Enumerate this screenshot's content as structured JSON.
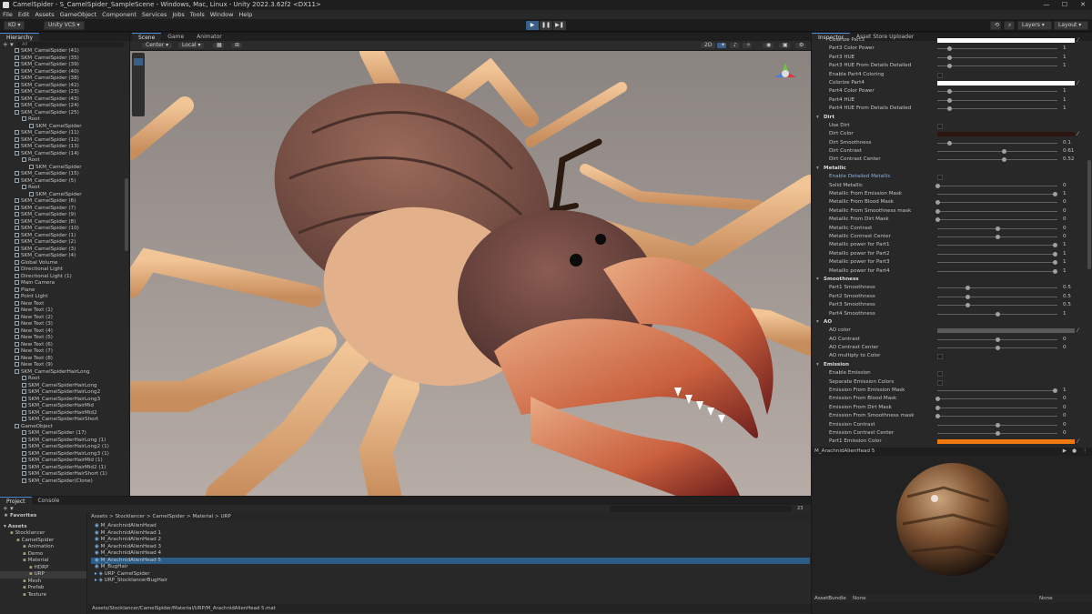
{
  "window": {
    "title": "CamelSpider - S_CamelSpider_SampleScene - Windows, Mac, Linux - Unity 2022.3.62f2 <DX11>",
    "controls": [
      "—",
      "☐",
      "✕"
    ]
  },
  "menu": [
    "File",
    "Edit",
    "Assets",
    "GameObject",
    "Component",
    "Services",
    "Jobs",
    "Tools",
    "Window",
    "Help"
  ],
  "toolbar": {
    "account": "KD ▾",
    "vcs": "Unity VCS ▾",
    "layers": "Layers ▾",
    "layout": "Layout ▾",
    "play": "▶",
    "pause": "❚❚",
    "step": "▶❚"
  },
  "hierarchy": {
    "tab": "Hierarchy",
    "search_placeholder": "All",
    "items": [
      "SKM_CamelSpider (41)",
      "SKM_CamelSpider (35)",
      "SKM_CamelSpider (39)",
      "SKM_CamelSpider (40)",
      "SKM_CamelSpider (38)",
      "SKM_CamelSpider (42)",
      "SKM_CamelSpider (23)",
      "SKM_CamelSpider (43)",
      "SKM_CamelSpider (24)",
      "SKM_CamelSpider (25)",
      "Root",
      "SKM_CamelSpider",
      "SKM_CamelSpider (11)",
      "SKM_CamelSpider (12)",
      "SKM_CamelSpider (13)",
      "SKM_CamelSpider (14)",
      "Root",
      "SKM_CamelSpider",
      "SKM_CamelSpider (15)",
      "SKM_CamelSpider (5)",
      "Root",
      "SKM_CamelSpider",
      "SKM_CamelSpider (6)",
      "SKM_CamelSpider (7)",
      "SKM_CamelSpider (9)",
      "SKM_CamelSpider (8)",
      "SKM_CamelSpider (10)",
      "SKM_CamelSpider (1)",
      "SKM_CamelSpider (2)",
      "SKM_CamelSpider (3)",
      "SKM_CamelSpider (4)",
      "Global Volume",
      "Directional Light",
      "Directional Light (1)",
      "Main Camera",
      "Plane",
      "Point Light",
      "New Text",
      "New Text (1)",
      "New Text (2)",
      "New Text (3)",
      "New Text (4)",
      "New Text (5)",
      "New Text (6)",
      "New Text (7)",
      "New Text (8)",
      "New Text (9)",
      "SKM_CamelSpiderHairLong",
      "Root",
      "SKM_CamelSpiderHairLong",
      "SKM_CamelSpiderHairLong2",
      "SKM_CamelSpiderHairLong3",
      "SKM_CamelSpiderHairMid",
      "SKM_CamelSpiderHairMid2",
      "SKM_CamelSpiderHairShort",
      "GameObject",
      "SKM_CamelSpider (17)",
      "SKM_CamelSpiderHairLong (1)",
      "SKM_CamelSpiderHairLong2 (1)",
      "SKM_CamelSpiderHairLong3 (1)",
      "SKM_CamelSpiderHairMid (1)",
      "SKM_CamelSpiderHairMid2 (1)",
      "SKM_CamelSpiderHairShort (1)",
      "SKM_CamelSpider(Clone)"
    ]
  },
  "scene": {
    "tabs": [
      "Scene",
      "Game",
      "Animator"
    ],
    "pivot": "Center ▾",
    "space": "Local ▾",
    "mode_2d": "2D"
  },
  "project": {
    "tabs": [
      "Project",
      "Console"
    ],
    "favorites": "Favorites",
    "assets_label": "Assets",
    "folders": [
      "Stocklancer",
      "CamelSpider",
      "Animation",
      "Demo",
      "Material",
      "HDRP",
      "URP",
      "Mesh",
      "Prefab",
      "Texture"
    ],
    "breadcrumb": "Assets > Stocklancer > CamelSpider > Material > URP",
    "files": [
      "M_ArachnidAlienHead",
      "M_ArachnidAlienHead 1",
      "M_ArachnidAlienHead 2",
      "M_ArachnidAlienHead 3",
      "M_ArachnidAlienHead 4",
      "M_ArachnidAlienHead 5",
      "M_BugHair",
      "URP_CamelSpider",
      "URP_StocklancerBugHair"
    ],
    "path": "Assets/Stocklancer/CamelSpider/Material/URP/M_ArachnidAlienHead 5.mat",
    "count": "23"
  },
  "inspector": {
    "tabs": [
      "Inspector",
      "Asset Store Uploader"
    ],
    "props": [
      {
        "label": "Colorize Part3",
        "type": "color",
        "color": "#ffffff"
      },
      {
        "label": "Part3 Color Power",
        "type": "slider",
        "value": "1",
        "pos": 0.1
      },
      {
        "label": "Part3 HUE",
        "type": "slider",
        "value": "1",
        "pos": 0.1
      },
      {
        "label": "Part3 HUE From Details Detailed",
        "type": "slider",
        "value": "1",
        "pos": 0.1
      },
      {
        "label": "Enable Part4 Coloring",
        "type": "check"
      },
      {
        "label": "Colorize Part4",
        "type": "color",
        "color": "#ffffff"
      },
      {
        "label": "Part4 Color Power",
        "type": "slider",
        "value": "1",
        "pos": 0.1
      },
      {
        "label": "Part4 HUE",
        "type": "slider",
        "value": "1",
        "pos": 0.1
      },
      {
        "label": "Part4 HUE From Details Detailed",
        "type": "slider",
        "value": "1",
        "pos": 0.1
      },
      {
        "label": "Dirt",
        "type": "header"
      },
      {
        "label": "Use Dirt",
        "type": "check"
      },
      {
        "label": "Dirt Color",
        "type": "color",
        "color": "#2a1510"
      },
      {
        "label": "Dirt Smoothness",
        "type": "slider",
        "value": "0.1",
        "pos": 0.1
      },
      {
        "label": "Dirt Contrast",
        "type": "slider",
        "value": "0.61",
        "pos": 0.55
      },
      {
        "label": "Dirt Contrast Center",
        "type": "slider",
        "value": "0.52",
        "pos": 0.55
      },
      {
        "label": "Metallic",
        "type": "header"
      },
      {
        "label": "Enable Detailed Metallic",
        "type": "check",
        "highlight": true
      },
      {
        "label": "Solid Metallic",
        "type": "slider",
        "value": "0",
        "pos": 0
      },
      {
        "label": "Metallic From Emission Mask",
        "type": "slider",
        "value": "1",
        "pos": 0.98
      },
      {
        "label": "Metallic From Blood Mask",
        "type": "slider",
        "value": "0",
        "pos": 0
      },
      {
        "label": "Metallic From Smoothness mask",
        "type": "slider",
        "value": "0",
        "pos": 0
      },
      {
        "label": "Metallic From Dirt Mask",
        "type": "slider",
        "value": "0",
        "pos": 0
      },
      {
        "label": "Metallic Contrast",
        "type": "slider",
        "value": "0",
        "pos": 0.5
      },
      {
        "label": "Metallic Contrast Center",
        "type": "slider",
        "value": "0",
        "pos": 0.5
      },
      {
        "label": "Metallic power for Part1",
        "type": "slider",
        "value": "1",
        "pos": 0.98
      },
      {
        "label": "Metallic power for Part2",
        "type": "slider",
        "value": "1",
        "pos": 0.98
      },
      {
        "label": "Metallic power for Part3",
        "type": "slider",
        "value": "1",
        "pos": 0.98
      },
      {
        "label": "Metallic power for Part4",
        "type": "slider",
        "value": "1",
        "pos": 0.98
      },
      {
        "label": "Smoothness",
        "type": "header"
      },
      {
        "label": "Part1 Smoothness",
        "type": "slider",
        "value": "0.5",
        "pos": 0.25
      },
      {
        "label": "Part2 Smoothness",
        "type": "slider",
        "value": "0.5",
        "pos": 0.25
      },
      {
        "label": "Part3 Smoothness",
        "type": "slider",
        "value": "0.5",
        "pos": 0.25
      },
      {
        "label": "Part4 Smoothness",
        "type": "slider",
        "value": "1",
        "pos": 0.5
      },
      {
        "label": "AO",
        "type": "header"
      },
      {
        "label": "AO color",
        "type": "color",
        "color": "#5a5a5a"
      },
      {
        "label": "AO Contrast",
        "type": "slider",
        "value": "0",
        "pos": 0.5
      },
      {
        "label": "AO Contrast Center",
        "type": "slider",
        "value": "0",
        "pos": 0.5
      },
      {
        "label": "AO multiply to Color",
        "type": "check"
      },
      {
        "label": "Emission",
        "type": "header"
      },
      {
        "label": "Enable Emission",
        "type": "check"
      },
      {
        "label": "Separate Emission Colors",
        "type": "check"
      },
      {
        "label": "Emission From Emission Mask",
        "type": "slider",
        "value": "1",
        "pos": 0.98
      },
      {
        "label": "Emission From Blood Mask",
        "type": "slider",
        "value": "0",
        "pos": 0
      },
      {
        "label": "Emission From Dirt Mask",
        "type": "slider",
        "value": "0",
        "pos": 0
      },
      {
        "label": "Emission From Smoothness mask",
        "type": "slider",
        "value": "0",
        "pos": 0
      },
      {
        "label": "Emission Contrast",
        "type": "slider",
        "value": "0",
        "pos": 0.5
      },
      {
        "label": "Emission Contrast Center",
        "type": "slider",
        "value": "0",
        "pos": 0.5
      },
      {
        "label": "Part1 Emission Color",
        "type": "color",
        "color": "#f07810"
      }
    ],
    "preview_title": "M_ArachnidAlienHead 5",
    "assetbundle": "AssetBundle",
    "ab_value": "None",
    "ab_variant": "None"
  },
  "colors": {
    "accent": "#2c5d87",
    "emission": "#f07810",
    "dirt": "#2a1510"
  }
}
